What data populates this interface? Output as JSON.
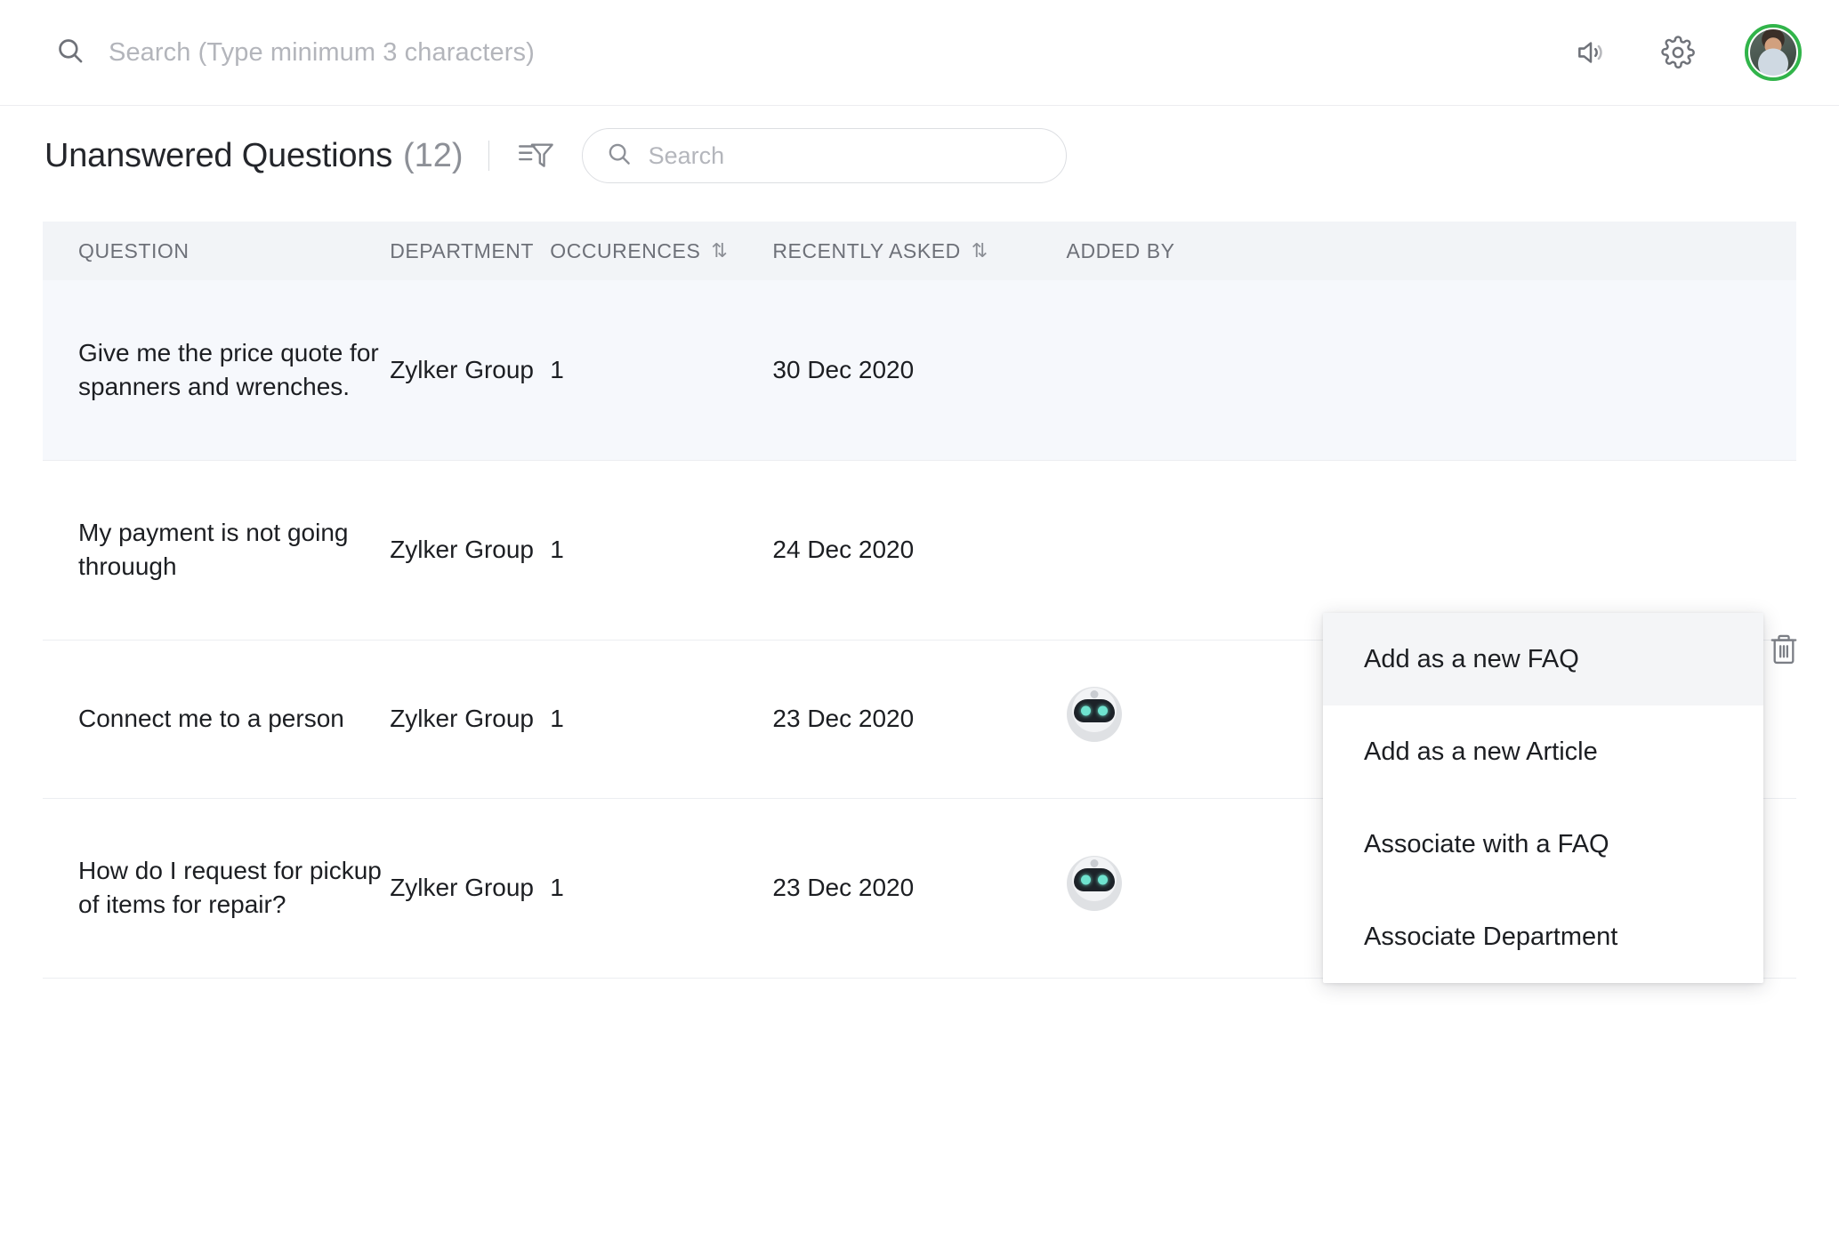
{
  "topbar": {
    "search_placeholder": "Search (Type minimum 3 characters)",
    "search_value": "",
    "announcement_icon": "speaker-icon",
    "settings_icon": "gear-icon",
    "avatar_ring_color": "#31b44a"
  },
  "page": {
    "title": "Unanswered Questions",
    "count": "(12)",
    "filter_icon": "filter-icon",
    "search_placeholder": "Search",
    "search_value": ""
  },
  "table": {
    "columns": [
      {
        "label": "QUESTION",
        "sortable": false
      },
      {
        "label": "DEPARTMENT",
        "sortable": false
      },
      {
        "label": "OCCURENCES",
        "sortable": true,
        "sort_icon": "⇅"
      },
      {
        "label": "RECENTLY ASKED",
        "sortable": true,
        "sort_icon": "⇅"
      },
      {
        "label": "ADDED BY",
        "sortable": false
      }
    ],
    "rows": [
      {
        "question": "Give me the price quote for spanners and wrenches.",
        "department": "Zylker Group",
        "occurences": "1",
        "recently_asked": "30 Dec 2020",
        "added_by": "",
        "added_by_icon": "",
        "active": true,
        "show_overflow": false
      },
      {
        "question": "My payment is not going throuugh",
        "department": "Zylker Group",
        "occurences": "1",
        "recently_asked": "24 Dec 2020",
        "added_by": "",
        "added_by_icon": "",
        "active": false,
        "show_overflow": false
      },
      {
        "question": "Connect me to a person",
        "department": "Zylker Group",
        "occurences": "1",
        "recently_asked": "23 Dec 2020",
        "added_by": "",
        "added_by_icon": "bot-avatar-icon",
        "active": false,
        "show_overflow": true
      },
      {
        "question": "How do I request for pickup of items for repair?",
        "department": "Zylker Group",
        "occurences": "1",
        "recently_asked": "23 Dec 2020",
        "added_by": "",
        "added_by_icon": "bot-avatar-icon",
        "active": false,
        "show_overflow": true
      }
    ],
    "delete_icon": "trash-icon",
    "overflow_icon": "more-options-icon"
  },
  "dropdown": {
    "items": [
      {
        "label": "Add as a new FAQ",
        "highlighted": true
      },
      {
        "label": "Add as a new Article",
        "highlighted": false
      },
      {
        "label": "Associate with a FAQ",
        "highlighted": false
      },
      {
        "label": "Associate Department",
        "highlighted": false
      }
    ]
  }
}
